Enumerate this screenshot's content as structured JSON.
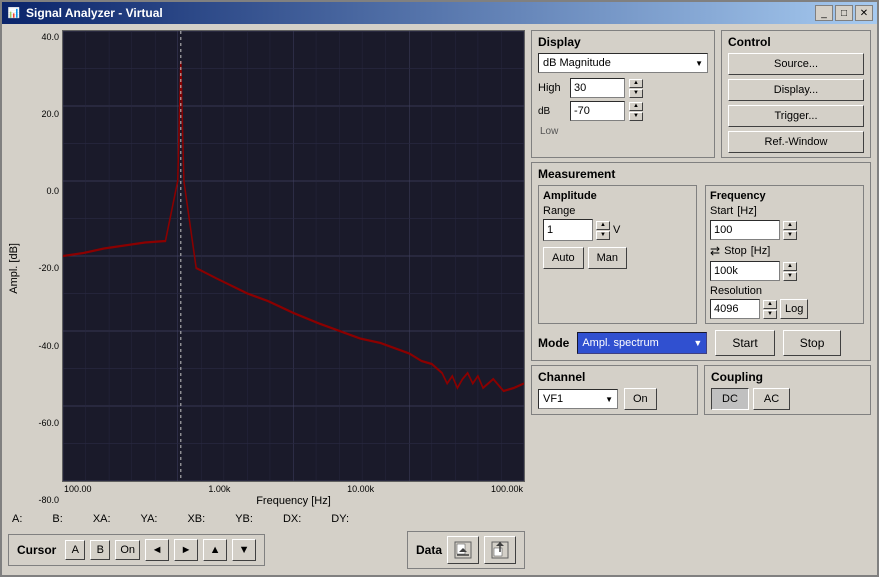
{
  "window": {
    "title": "Signal Analyzer - Virtual"
  },
  "display": {
    "label": "Display",
    "mode": "dB Magnitude",
    "high_label": "High",
    "high_value": "30",
    "dB_label": "dB",
    "low_label": "Low",
    "low_value": "-70"
  },
  "control": {
    "label": "Control",
    "source_btn": "Source...",
    "display_btn": "Display...",
    "trigger_btn": "Trigger...",
    "refwindow_btn": "Ref.-Window"
  },
  "measurement": {
    "label": "Measurement",
    "amplitude": {
      "label": "Amplitude",
      "range_label": "Range",
      "range_value": "1",
      "unit": "V",
      "auto_btn": "Auto",
      "man_btn": "Man"
    },
    "frequency": {
      "label": "Frequency",
      "start_label": "Start",
      "hz_label": "[Hz]",
      "start_value": "100",
      "stop_label": "Stop",
      "hz_label2": "[Hz]",
      "stop_value": "100k",
      "resolution_label": "Resolution",
      "resolution_value": "4096",
      "log_btn": "Log"
    }
  },
  "mode": {
    "label": "Mode",
    "value": "Ampl. spectrum",
    "start_btn": "Start",
    "stop_btn": "Stop"
  },
  "channel": {
    "label": "Channel",
    "value": "VF1",
    "on_btn": "On"
  },
  "coupling": {
    "label": "Coupling",
    "dc_btn": "DC",
    "ac_btn": "AC"
  },
  "cursor": {
    "label": "Cursor",
    "a_btn": "A",
    "b_btn": "B",
    "on_btn": "On",
    "left_btn": "◄",
    "right_btn": "►",
    "up_btn": "▲",
    "down_btn": "▼"
  },
  "data": {
    "label": "Data"
  },
  "cursor_data": {
    "a_label": "A:",
    "b_label": "B:",
    "xa_label": "XA:",
    "ya_label": "YA:",
    "xb_label": "XB:",
    "yb_label": "YB:",
    "dx_label": "DX:",
    "dy_label": "DY:",
    "a_val": "",
    "b_val": "",
    "xa_val": "",
    "ya_val": "",
    "xb_val": "",
    "yb_val": "",
    "dx_val": "",
    "dy_val": ""
  },
  "chart": {
    "y_labels": [
      "40.0",
      "20.0",
      "0.0",
      "-20.0",
      "-40.0",
      "-60.0",
      "-80.0"
    ],
    "x_labels": [
      "100.00",
      "1.00k",
      "10.00k",
      "100.00k"
    ],
    "y_axis_title": "Ampl. [dB]",
    "x_axis_title": "Frequency [Hz]"
  }
}
